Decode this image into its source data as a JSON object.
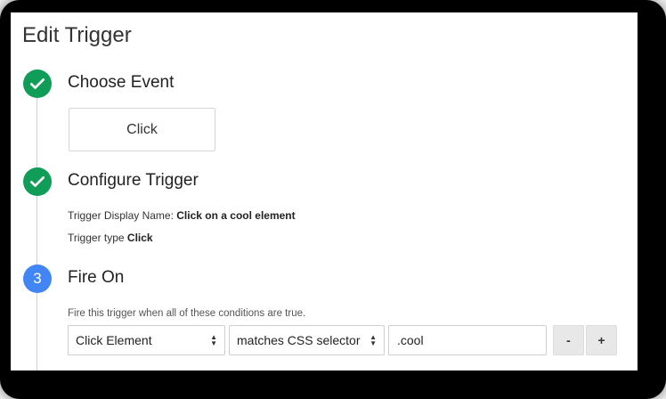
{
  "header": {
    "title": "Edit Trigger"
  },
  "steps": [
    {
      "marker": "check-icon",
      "title": "Choose Event",
      "status": "done"
    },
    {
      "marker": "check-icon",
      "title": "Configure Trigger",
      "status": "done"
    },
    {
      "marker": "3",
      "title": "Fire On",
      "status": "active"
    }
  ],
  "event": {
    "selected": "Click"
  },
  "configure": {
    "display_name_label": "Trigger Display Name: ",
    "display_name_value": "Click on a cool element",
    "type_label": "Trigger type ",
    "type_value": "Click"
  },
  "fire_on": {
    "hint": "Fire this trigger when all of these conditions are true.",
    "variable": "Click Element",
    "operator": "matches CSS selector",
    "value": ".cool",
    "remove_label": "-",
    "add_label": "+"
  },
  "colors": {
    "done": "#0f9d58",
    "active": "#4285f4"
  }
}
